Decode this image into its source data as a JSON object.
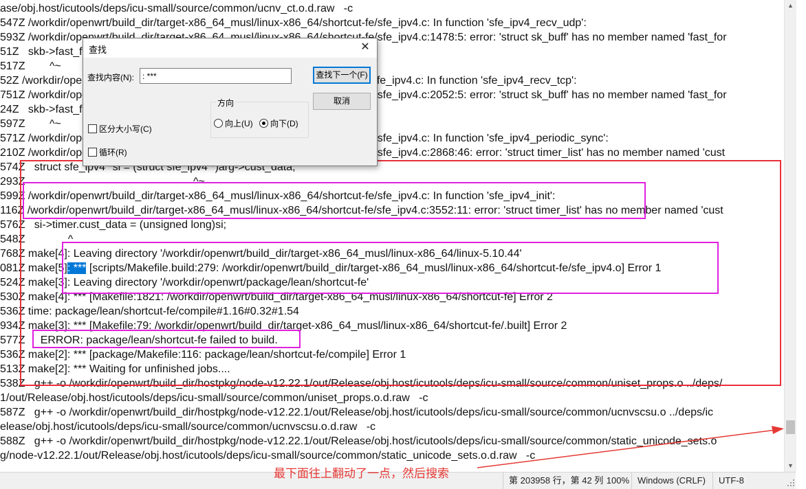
{
  "editor": {
    "lines": [
      {
        "text": "ase/obj.host/icutools/deps/icu-small/source/common/ucnv_ct.o.d.raw   -c"
      },
      {
        "text": "547Z /workdir/openwrt/build_dir/target-x86_64_musl/linux-x86_64/shortcut-fe/sfe_ipv4.c: In function 'sfe_ipv4_recv_udp':"
      },
      {
        "text": "593Z /workdir/openwrt/build_dir/target-x86_64_musl/linux-x86_64/shortcut-fe/sfe_ipv4.c:1478:5: error: 'struct sk_buff' has no member named 'fast_for"
      },
      {
        "text": "51Z   skb->fast_forwarded = 1;"
      },
      {
        "text": "517Z        ^~"
      },
      {
        "text": "52Z /workdir/openwrt/build_dir/target-x86_64_musl/linux-x86_64/shortcut-fe/sfe_ipv4.c: In function 'sfe_ipv4_recv_tcp':"
      },
      {
        "text": "751Z /workdir/openwrt/build_dir/target-x86_64_musl/linux-x86_64/shortcut-fe/sfe_ipv4.c:2052:5: error: 'struct sk_buff' has no member named 'fast_for"
      },
      {
        "text": "24Z   skb->fast_forwarded = 1;"
      },
      {
        "text": "597Z        ^~"
      },
      {
        "text": "571Z /workdir/openwrt/build_dir/target-x86_64_musl/linux-x86_64/shortcut-fe/sfe_ipv4.c: In function 'sfe_ipv4_periodic_sync':"
      },
      {
        "text": "210Z /workdir/openwrt/build_dir/target-x86_64_musl/linux-x86_64/shortcut-fe/sfe_ipv4.c:2868:46: error: 'struct timer_list' has no member named 'cust"
      },
      {
        "text": "574Z   struct sfe_ipv4 *si = (struct sfe_ipv4 *)arg->cust_data;"
      },
      {
        "text": "293Z                                                       ^~"
      },
      {
        "text": "599Z /workdir/openwrt/build_dir/target-x86_64_musl/linux-x86_64/shortcut-fe/sfe_ipv4.c: In function 'sfe_ipv4_init':"
      },
      {
        "text": "116Z /workdir/openwrt/build_dir/target-x86_64_musl/linux-x86_64/shortcut-fe/sfe_ipv4.c:3552:11: error: 'struct timer_list' has no member named 'cust"
      },
      {
        "text": "576Z   si->timer.cust_data = (unsigned long)si;"
      },
      {
        "text": "548Z              ^"
      },
      {
        "text": "768Z make[4]: Leaving directory '/workdir/openwrt/build_dir/target-x86_64_musl/linux-x86_64/linux-5.10.44'"
      },
      {
        "pre": "081Z make[5]",
        "sel": ": ***",
        "post": " [scripts/Makefile.build:279: /workdir/openwrt/build_dir/target-x86_64_musl/linux-x86_64/shortcut-fe/sfe_ipv4.o] Error 1"
      },
      {
        "text": "524Z make[3]: Leaving directory '/workdir/openwrt/package/lean/shortcut-fe'"
      },
      {
        "text": "530Z make[4]: *** [Makefile:1821: /workdir/openwrt/build_dir/target-x86_64_musl/linux-x86_64/shortcut-fe] Error 2"
      },
      {
        "text": "536Z time: package/lean/shortcut-fe/compile#1.16#0.32#1.54"
      },
      {
        "text": "934Z make[3]: *** [Makefile:79: /workdir/openwrt/build_dir/target-x86_64_musl/linux-x86_64/shortcut-fe/.built] Error 2"
      },
      {
        "text": "577Z     ERROR: package/lean/shortcut-fe failed to build."
      },
      {
        "text": "536Z make[2]: *** [package/Makefile:116: package/lean/shortcut-fe/compile] Error 1"
      },
      {
        "text": "513Z make[2]: *** Waiting for unfinished jobs...."
      },
      {
        "text": "538Z   g++ -o /workdir/openwrt/build_dir/hostpkg/node-v12.22.1/out/Release/obj.host/icutools/deps/icu-small/source/common/uniset_props.o ../deps/"
      },
      {
        "text": "1/out/Release/obj.host/icutools/deps/icu-small/source/common/uniset_props.o.d.raw   -c"
      },
      {
        "text": "587Z   g++ -o /workdir/openwrt/build_dir/hostpkg/node-v12.22.1/out/Release/obj.host/icutools/deps/icu-small/source/common/ucnvscsu.o ../deps/ic"
      },
      {
        "text": "elease/obj.host/icutools/deps/icu-small/source/common/ucnvscsu.o.d.raw   -c"
      },
      {
        "text": "588Z   g++ -o /workdir/openwrt/build_dir/hostpkg/node-v12.22.1/out/Release/obj.host/icutools/deps/icu-small/source/common/static_unicode_sets.o"
      },
      {
        "text": "g/node-v12.22.1/out/Release/obj.host/icutools/deps/icu-small/source/common/static_unicode_sets.o.d.raw   -c"
      }
    ]
  },
  "find_dialog": {
    "title": "查找",
    "find_label": "查找内容(N):",
    "find_value": ": ***",
    "find_next_label": "查找下一个(F)",
    "cancel_label": "取消",
    "direction_label": "方向",
    "up_label": "向上(U)",
    "down_label": "向下(D)",
    "direction_selected": "down",
    "match_case_label": "区分大小写(C)",
    "wrap_label": "循环(R)",
    "close_icon": "close-icon"
  },
  "status_bar": {
    "position": "第 203958 行，第 42 列",
    "zoom": "100%",
    "line_ending": "Windows (CRLF)",
    "encoding": "UTF-8"
  },
  "annotation": {
    "text": "最下面往上翻动了一点，然后搜索",
    "color": "#e53935",
    "highlight_colors": {
      "red": "#e8303a",
      "magenta": "#e020e0"
    }
  }
}
